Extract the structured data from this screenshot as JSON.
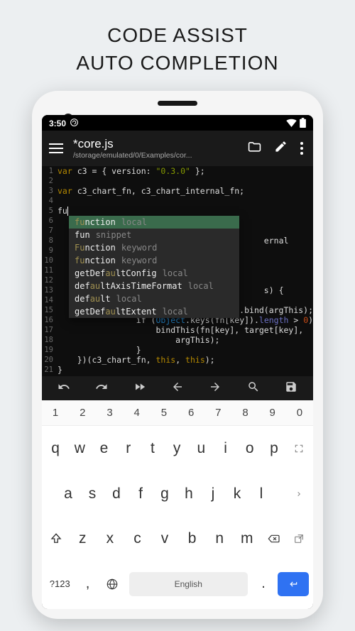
{
  "promo": {
    "line1": "CODE ASSIST",
    "line2": "AUTO COMPLETION"
  },
  "status": {
    "time": "3:50"
  },
  "app": {
    "filename": "*core.js",
    "filepath": "/storage/emulated/0/Examples/cor..."
  },
  "code": {
    "n1": "1",
    "c1a": "var",
    "c1b": " c3 = { version: ",
    "c1c": "\"0.3.0\"",
    "c1d": " };",
    "n2": "2",
    "n3": "3",
    "c3a": "var",
    "c3b": " c3_chart_fn, c3_chart_internal_fn;",
    "n4": "4",
    "n5": "5",
    "c5": "fu",
    "n6": "6",
    "n7": "7",
    "n8": "8",
    "c8": "ernal",
    "n9": "9",
    "n10": "10",
    "n11": "11",
    "n12": "12",
    "n13": "13",
    "c13": "s) {",
    "n14": "14",
    "n15": "15",
    "c15": "                target[key] = fn[key].bind(argThis);",
    "n16": "16",
    "c16a": "                if (",
    "c16b": "Object",
    "c16c": ".keys(fn[key]).",
    "c16d": "length",
    "c16e": " > ",
    "c16f": "0",
    "c16g": ") {",
    "n17": "17",
    "c17": "                    bindThis(fn[key], target[key],",
    "n18": "18",
    "c18": "                        argThis);",
    "n19": "19",
    "c19": "                }",
    "n20": "20",
    "c20a": "    })(c3_chart_fn, ",
    "c20b": "this",
    "c20c": ", ",
    "c20d": "this",
    "c20e": ");",
    "n21": "21",
    "c21": "}"
  },
  "suggestions": [
    {
      "n": "function",
      "t": "local",
      "hl": "fu"
    },
    {
      "n": "fun",
      "t": "snippet",
      "hl": ""
    },
    {
      "n": "function",
      "t": "keyword",
      "hl": "Fu"
    },
    {
      "n": "function",
      "t": "keyword",
      "hl": "fu"
    },
    {
      "n": "getDefaultConfig",
      "t": "local",
      "hl": "au"
    },
    {
      "n": "defaultAxisTimeFormat",
      "t": "local",
      "hl": "au"
    },
    {
      "n": "default",
      "t": "local",
      "hl": "au"
    },
    {
      "n": "getDefaultExtent",
      "t": "local",
      "hl": "au"
    }
  ],
  "keyboard": {
    "nums": [
      "1",
      "2",
      "3",
      "4",
      "5",
      "6",
      "7",
      "8",
      "9",
      "0"
    ],
    "row1": [
      "q",
      "w",
      "e",
      "r",
      "t",
      "y",
      "u",
      "i",
      "o",
      "p"
    ],
    "row2": [
      "a",
      "s",
      "d",
      "f",
      "g",
      "h",
      "j",
      "k",
      "l"
    ],
    "row3": [
      "z",
      "x",
      "c",
      "v",
      "b",
      "n",
      "m"
    ],
    "switch": "?123",
    "comma": ",",
    "space": "English",
    "dot": "."
  }
}
